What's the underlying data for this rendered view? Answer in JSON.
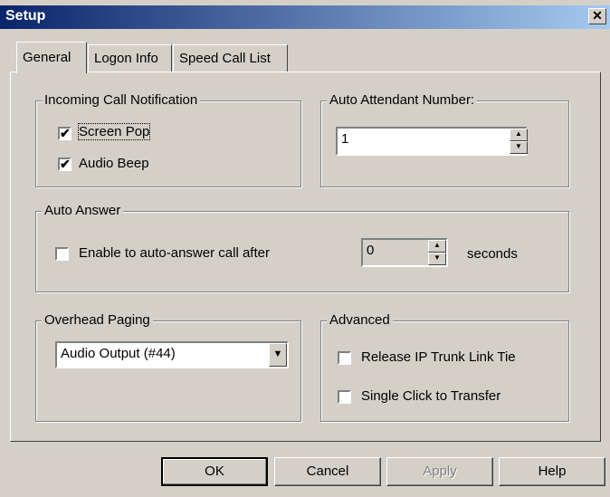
{
  "window": {
    "title": "Setup",
    "close_glyph": "✕"
  },
  "tabs": [
    {
      "label": "General",
      "active": true
    },
    {
      "label": "Logon Info",
      "active": false
    },
    {
      "label": "Speed Call List",
      "active": false
    }
  ],
  "incoming": {
    "legend": "Incoming Call Notification",
    "screen_pop": {
      "label": "Screen Pop",
      "checked": true,
      "glyph": "✔"
    },
    "audio_beep": {
      "label": "Audio Beep",
      "checked": true,
      "glyph": "✔"
    }
  },
  "auto_attendant": {
    "legend": "Auto Attendant Number:",
    "value": "1"
  },
  "auto_answer": {
    "legend": "Auto Answer",
    "enable_label": "Enable to auto-answer call after",
    "enabled": false,
    "value": "0",
    "unit": "seconds"
  },
  "overhead_paging": {
    "legend": "Overhead Paging",
    "selected": "Audio Output (#44)"
  },
  "advanced": {
    "legend": "Advanced",
    "release_ip": {
      "label": "Release IP Trunk Link Tie",
      "checked": false
    },
    "single_click": {
      "label": "Single Click to Transfer",
      "checked": false
    }
  },
  "buttons": {
    "ok": "OK",
    "cancel": "Cancel",
    "apply": "Apply",
    "help": "Help"
  },
  "colors": {
    "titlebar_start": "#0a246a",
    "titlebar_end": "#a6caf0",
    "face": "#d4d0c8"
  }
}
